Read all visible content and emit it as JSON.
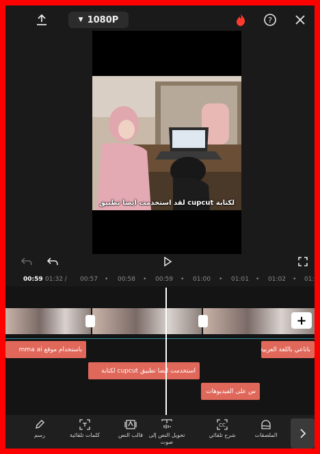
{
  "topbar": {
    "resolution": "1080P"
  },
  "preview": {
    "caption": "لقد استخدمت ايضا تطبيق cupcut لكتابة"
  },
  "ruler": {
    "current": "00:59",
    "total": "01:32 /",
    "ticks": [
      "00:57",
      "00:58",
      "00:59",
      "01:00",
      "01:01",
      "01:02",
      "01:0"
    ]
  },
  "text_clips": [
    {
      "label": "باستخدام موقع mma ai"
    },
    {
      "label": "باتاعي باللغة العربية"
    },
    {
      "label": "استخدمت ايضا تطبيق cupcut لكتابة"
    },
    {
      "label": "س على الفيديوهات"
    }
  ],
  "toolbar": {
    "items": [
      {
        "label": "رسم",
        "icon": "pen-icon"
      },
      {
        "label": "كلمات تلقائية",
        "icon": "auto-words-icon"
      },
      {
        "label": "قالب النص",
        "icon": "text-template-icon"
      },
      {
        "label": "تحويل النص إلى صوت",
        "icon": "text-to-speech-icon"
      },
      {
        "label": "شرح تلقائي",
        "icon": "captions-icon"
      },
      {
        "label": "الملصقات",
        "icon": "sticker-icon"
      }
    ]
  },
  "colors": {
    "clip": "#e0685a",
    "background": "#1a1a1a",
    "frame": "#ff0000"
  }
}
